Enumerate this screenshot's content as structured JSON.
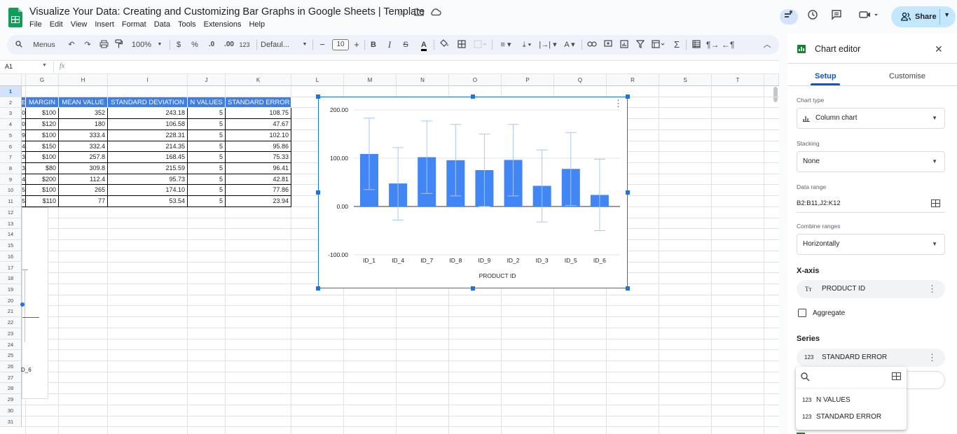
{
  "doc": {
    "title": "Visualize Your Data: Creating and Customizing Bar Graphs in Google Sheets | Template"
  },
  "menu": [
    "File",
    "Edit",
    "View",
    "Insert",
    "Format",
    "Data",
    "Tools",
    "Extensions",
    "Help"
  ],
  "share": {
    "label": "Share"
  },
  "toolbar": {
    "search": "Menus",
    "zoom": "100%",
    "currency": "$",
    "percent": "%",
    "dec_less": ".0",
    "dec_more": ".00",
    "format123": "123",
    "font": "Defaul...",
    "font_size": "10"
  },
  "formula_bar": {
    "cell_ref": "A1",
    "fx": "fx"
  },
  "grid": {
    "columns": [
      "G",
      "H",
      "I",
      "J",
      "K",
      "L",
      "M",
      "N",
      "O",
      "P",
      "Q",
      "R",
      "S",
      "T"
    ],
    "rows": [
      "1",
      "2",
      "3",
      "4",
      "5",
      "6",
      "7",
      "8",
      "9",
      "10",
      "11",
      "12",
      "13",
      "14",
      "15",
      "16",
      "17",
      "18",
      "19",
      "20",
      "21",
      "22",
      "23",
      "24",
      "25",
      "26",
      "27",
      "28",
      "29",
      "30",
      "31"
    ],
    "table_headers": [
      "E",
      "MARGIN",
      "MEAN VALUE",
      "STANDARD DEVIATION",
      "N VALUES",
      "STANDARD ERROR"
    ],
    "table_rows": [
      [
        "0",
        "$100",
        "352",
        "243.18",
        "5",
        "108.75"
      ],
      [
        "0",
        "$120",
        "180",
        "106.58",
        "5",
        "47.67"
      ],
      [
        "9",
        "$100",
        "333.4",
        "228.31",
        "5",
        "102.10"
      ],
      [
        "4",
        "$150",
        "332.4",
        "214.35",
        "5",
        "95.86"
      ],
      [
        "3",
        "$100",
        "257.8",
        "168.45",
        "5",
        "75.33"
      ],
      [
        "3",
        "$80",
        "309.8",
        "215.59",
        "5",
        "96.41"
      ],
      [
        "4",
        "$200",
        "112.4",
        "95.73",
        "5",
        "42.81"
      ],
      [
        "5",
        "$100",
        "265",
        "174.10",
        "5",
        "77.86"
      ],
      [
        "5",
        "$110",
        "77",
        "53.54",
        "5",
        "23.94"
      ]
    ],
    "ghost_label": "D_6"
  },
  "chart_data": {
    "type": "bar",
    "categories": [
      "ID_1",
      "ID_4",
      "ID_7",
      "ID_8",
      "ID_9",
      "ID_2",
      "ID_3",
      "ID_5",
      "ID_6"
    ],
    "values": [
      108.75,
      47.67,
      102.1,
      95.86,
      75.33,
      96.41,
      42.81,
      77.86,
      23.94
    ],
    "error_low": [
      35,
      -28,
      27,
      22,
      0,
      22,
      -32,
      2,
      -50
    ],
    "error_high": [
      183,
      122,
      177,
      170,
      150,
      170,
      117,
      153,
      98
    ],
    "xlabel": "PRODUCT ID",
    "ylabel": "",
    "ylim": [
      -100,
      200
    ],
    "yticks": [
      "200.00",
      "100.00",
      "0.00",
      "-100.00"
    ],
    "bar_color": "#4285f4",
    "grid": true
  },
  "editor": {
    "title": "Chart editor",
    "tabs": [
      "Setup",
      "Customise"
    ],
    "chart_type_label": "Chart type",
    "chart_type": "Column chart",
    "stacking_label": "Stacking",
    "stacking": "None",
    "data_range_label": "Data range",
    "data_range": "B2:B11,J2:K12",
    "combine_label": "Combine ranges",
    "combine": "Horizontally",
    "xaxis_label": "X-axis",
    "xaxis_value": "PRODUCT ID",
    "aggregate": "Aggregate",
    "series_label": "Series",
    "series_value": "STANDARD ERROR",
    "popup_options": [
      "N VALUES",
      "STANDARD ERROR"
    ]
  },
  "colors": {
    "accent": "#1a73e8",
    "header_fill": "#3f7ee8",
    "bar": "#4285f4"
  }
}
